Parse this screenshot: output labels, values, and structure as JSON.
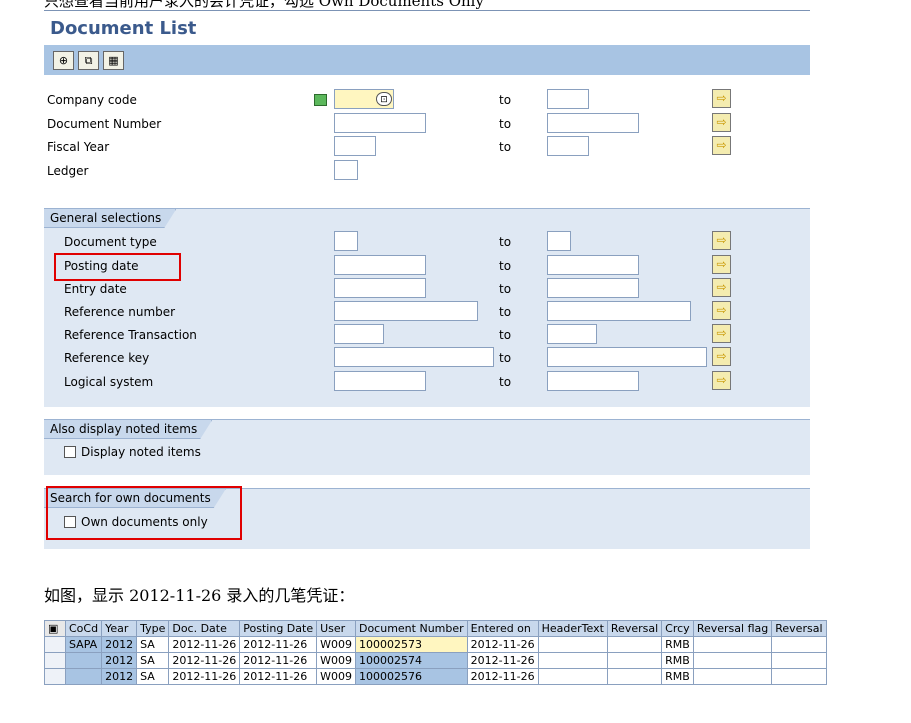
{
  "top_text": "只想查看当前用户录入的会计凭证，勾选 Own Documents Only",
  "window": {
    "title": "Document List"
  },
  "toolbar": {
    "buttons": [
      {
        "icon": "execute-icon",
        "glyph": "⊕"
      },
      {
        "icon": "copy-icon",
        "glyph": "⧉"
      },
      {
        "icon": "grid-icon",
        "glyph": "▦"
      }
    ]
  },
  "main_fields": {
    "to_label": "to",
    "company_code": {
      "label": "Company code",
      "value": ""
    },
    "document_number": {
      "label": "Document Number",
      "value": ""
    },
    "fiscal_year": {
      "label": "Fiscal Year",
      "value": ""
    },
    "ledger": {
      "label": "Ledger",
      "value": ""
    }
  },
  "general": {
    "title": "General selections",
    "document_type": "Document type",
    "posting_date": "Posting date",
    "entry_date": "Entry date",
    "reference_number": "Reference number",
    "reference_transaction": "Reference Transaction",
    "reference_key": "Reference key",
    "logical_system": "Logical system"
  },
  "noted": {
    "title": "Also display noted items",
    "checkbox_label": "Display noted items",
    "checked": false
  },
  "own": {
    "title": "Search for own documents",
    "checkbox_label": "Own documents only",
    "checked": false
  },
  "caption": "如图，显示 2012-11-26 录入的几笔凭证：",
  "table": {
    "columns": [
      "CoCd",
      "Year",
      "Type",
      "Doc. Date",
      "Posting Date",
      "User",
      "Document Number",
      "Entered on",
      "HeaderText",
      "Reversal",
      "Crcy",
      "Reversal flag",
      "Reversal"
    ],
    "rows": [
      [
        "SAPA",
        "2012",
        "SA",
        "2012-11-26",
        "2012-11-26",
        "W009",
        "100002573",
        "2012-11-26",
        "",
        "",
        "RMB",
        "",
        ""
      ],
      [
        "",
        "2012",
        "SA",
        "2012-11-26",
        "2012-11-26",
        "W009",
        "100002574",
        "2012-11-26",
        "",
        "",
        "RMB",
        "",
        ""
      ],
      [
        "",
        "2012",
        "SA",
        "2012-11-26",
        "2012-11-26",
        "W009",
        "100002576",
        "2012-11-26",
        "",
        "",
        "RMB",
        "",
        ""
      ]
    ]
  }
}
